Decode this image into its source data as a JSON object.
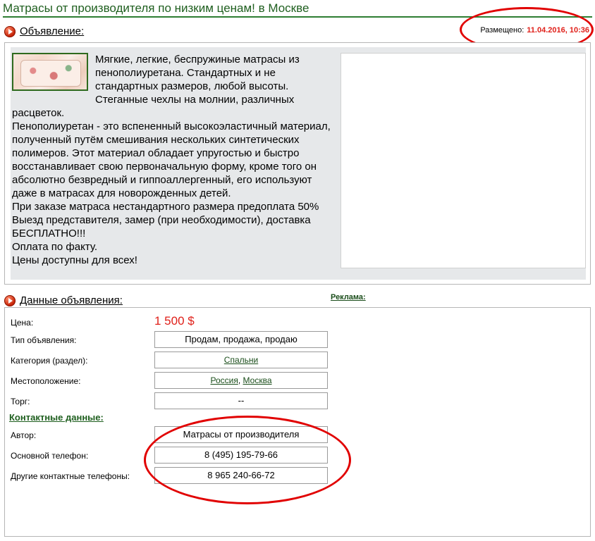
{
  "page": {
    "title": "Матрасы от производителя по низким ценам! в Москве"
  },
  "ad_section": {
    "heading": "Объявление:",
    "placed_label": "Размещено:",
    "placed_date": "11.04.2016, 10:36",
    "image_icon": "mattress-photo",
    "description": [
      "Мягкие, легкие, беспружиные матрасы из пенополиуретана. Стандартных и не стандартных размеров, любой высоты. Стеганные чехлы на молнии, различных расцветок.",
      "Пенополиуретан - это вспененный высокоэластичный материал, полученный путём смешивания нескольких синтетических полимеров. Этот материал обладает упругостью и быстро восстанавливает свою первоначальную форму, кроме того он абсолютно безвредный и гиппоаллергенный, его используют даже в матрасах для новорожденных детей.",
      "При заказе матраса нестандартного размера предоплата 50%",
      "Выезд представителя, замер (при необходимости), доставка БЕСПЛАТНО!!!",
      "Оплата по факту.",
      "Цены доступны для всех!"
    ]
  },
  "details_section": {
    "heading": "Данные объявления:",
    "ads_link": "Реклама:",
    "price_label": "Цена:",
    "price_value": "1 500 $",
    "type_label": "Тип объявления:",
    "type_value": "Продам, продажа, продаю",
    "category_label": "Категория (раздел):",
    "category_value": "Спальни",
    "location_label": "Местоположение:",
    "location_country": "Россия",
    "location_separator": ", ",
    "location_city": "Москва",
    "bargain_label": "Торг:",
    "bargain_value": "--",
    "contacts_heading": "Контактные данные:",
    "author_label": "Автор:",
    "author_value": "Матрасы от производителя",
    "phone_label": "Основной телефон:",
    "phone_value": "8 (495) 195-79-66",
    "other_phones_label": "Другие контактные телефоны:",
    "other_phones_value": "8 965 240-66-72"
  },
  "colors": {
    "title_green": "#1f5f1f",
    "price_red": "#e0201a",
    "annotation_red": "#e10000"
  }
}
